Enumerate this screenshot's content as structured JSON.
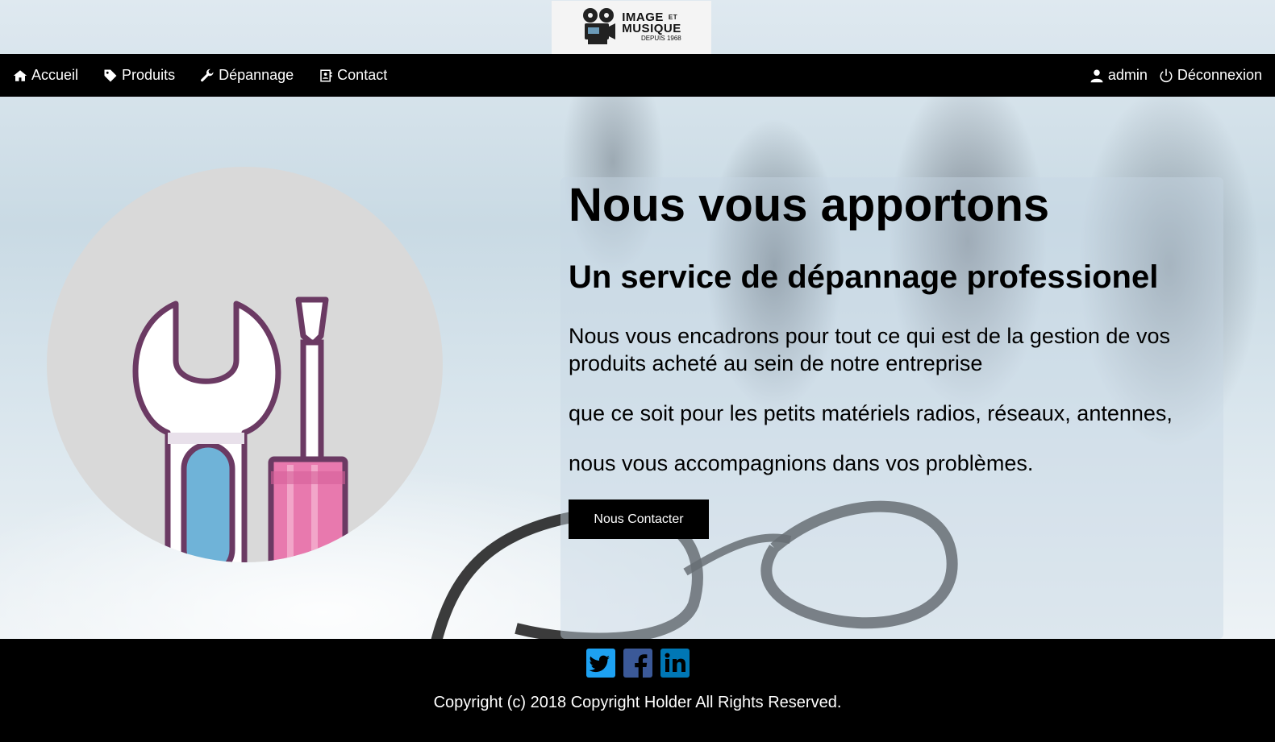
{
  "header": {
    "logo": {
      "line1": "IMAGE",
      "et": "ET",
      "line2": "MUSIQUE",
      "line3": "DEPUIS 1968"
    }
  },
  "nav": {
    "left": [
      {
        "label": "Accueil",
        "icon": "home-icon"
      },
      {
        "label": "Produits",
        "icon": "tag-icon"
      },
      {
        "label": "Dépannage",
        "icon": "wrench-icon"
      },
      {
        "label": "Contact",
        "icon": "contact-card-icon"
      }
    ],
    "right": [
      {
        "label": "admin",
        "icon": "user-icon"
      },
      {
        "label": "Déconnexion",
        "icon": "power-icon"
      }
    ]
  },
  "hero": {
    "title": "Nous vous apportons",
    "subtitle": "Un service de dépannage professionel",
    "para1": "Nous vous encadrons pour tout ce qui est de la gestion de vos produits acheté au sein de notre entreprise",
    "para2": "que ce soit pour les petits matériels radios, réseaux, antennes,",
    "para3": "nous vous accompagnions dans vos problèmes.",
    "button": "Nous Contacter"
  },
  "footer": {
    "social": [
      "twitter-icon",
      "facebook-icon",
      "linkedin-icon"
    ],
    "copyright": "Copyright (c) 2018 Copyright Holder All Rights Reserved."
  },
  "colors": {
    "navbar": "#000000",
    "card_bg": "#c8d8e4",
    "social_blue": "#1da1f2",
    "facebook_blue": "#3b5998",
    "linkedin_blue": "#0077b5",
    "wrench_outline": "#6b3a63",
    "screwdriver_pink": "#e879ae"
  }
}
